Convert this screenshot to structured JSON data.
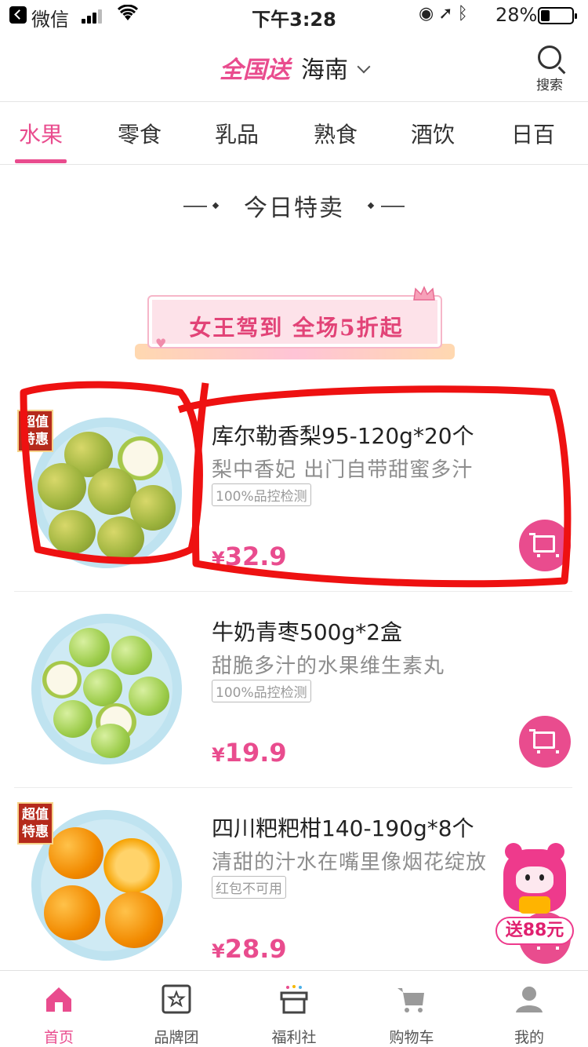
{
  "status_bar": {
    "app_name": "微信",
    "time": "下午3:28",
    "battery": "28%",
    "battery_level": 0.28
  },
  "header": {
    "nation_label": "全国送",
    "city": "海南",
    "search_label": "搜索"
  },
  "tabs": [
    {
      "label": "水果",
      "active": true
    },
    {
      "label": "零食",
      "active": false
    },
    {
      "label": "乳品",
      "active": false
    },
    {
      "label": "熟食",
      "active": false
    },
    {
      "label": "酒饮",
      "active": false
    },
    {
      "label": "日百",
      "active": false
    }
  ],
  "section": {
    "title": "今日特卖"
  },
  "banner": {
    "text": "女王驾到 全场5折起"
  },
  "products": [
    {
      "title": "库尔勒香梨95-120g*20个",
      "subtitle": "梨中香妃  出门自带甜蜜多汁",
      "tag": "100%品控检测",
      "price": "32.9",
      "badge": [
        "超值",
        "特惠"
      ]
    },
    {
      "title": "牛奶青枣500g*2盒",
      "subtitle": "甜脆多汁的水果维生素丸",
      "tag": "100%品控检测",
      "price": "19.9",
      "badge": []
    },
    {
      "title": "四川粑粑柑140-190g*8个",
      "subtitle": "清甜的汁水在嘴里像烟花绽放",
      "tag": "红包不可用",
      "price": "28.9",
      "badge": [
        "超值",
        "特惠"
      ]
    }
  ],
  "currency": "¥",
  "promo": {
    "label": "送88元"
  },
  "tabbar": [
    {
      "label": "首页",
      "icon": "home-icon",
      "active": true
    },
    {
      "label": "品牌团",
      "icon": "star-box-icon",
      "active": false
    },
    {
      "label": "福利社",
      "icon": "gift-icon",
      "active": false
    },
    {
      "label": "购物车",
      "icon": "cart-icon",
      "active": false
    },
    {
      "label": "我的",
      "icon": "user-icon",
      "active": false
    }
  ],
  "colors": {
    "accent": "#e94c8e",
    "annotation": "#ee1111"
  }
}
